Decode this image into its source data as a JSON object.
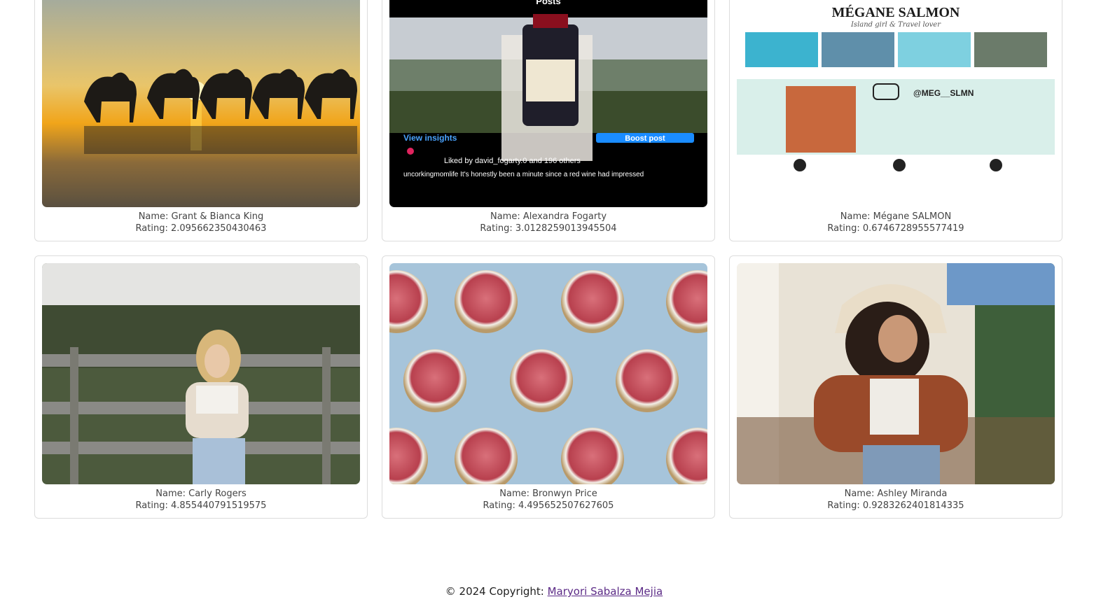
{
  "cards": [
    {
      "name_text": "Name: Grant & Bianca King",
      "rating_text": "Rating: 2.095662350430463",
      "image": "camels-sunset-beach"
    },
    {
      "name_text": "Name: Alexandra Fogarty",
      "rating_text": "Rating: 3.0128259013945504",
      "image": "instagram-wine-post",
      "overlay": {
        "title": "Posts",
        "insights": "View insights",
        "boost": "Boost post",
        "liked": "Liked by david_fogarty.0 and 196 others",
        "caption": "uncorkingmomlife It's honestly been a minute since a red wine had impressed"
      }
    },
    {
      "name_text": "Name: Mégane SALMON",
      "rating_text": "Rating: 0.6746728955577419",
      "image": "media-kit",
      "overlay": {
        "title": "MÉGANE SALMON",
        "subtitle": "Island girl & Travel lover",
        "handle": "@MEG__SLMN"
      }
    },
    {
      "name_text": "Name: Carly Rogers",
      "rating_text": "Rating: 4.855440791519575",
      "image": "woman-by-fence"
    },
    {
      "name_text": "Name: Bronwyn Price",
      "rating_text": "Rating: 4.495652507627605",
      "image": "pink-dishes-pattern"
    },
    {
      "name_text": "Name: Ashley Miranda",
      "rating_text": "Rating: 0.9283262401814335",
      "image": "woman-bucket-hat"
    }
  ],
  "footer": {
    "copyright": "© 2024 Copyright: ",
    "author": "Maryori Sabalza Mejia"
  }
}
